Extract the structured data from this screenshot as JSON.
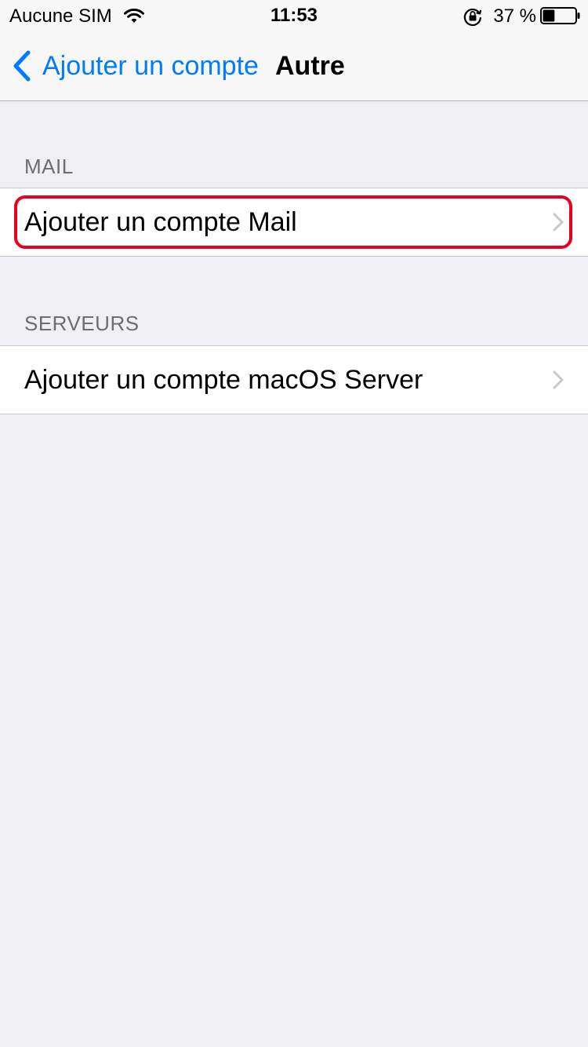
{
  "status_bar": {
    "carrier": "Aucune SIM",
    "time": "11:53",
    "battery": "37 %",
    "battery_level": 0.37,
    "icons": [
      "wifi-icon",
      "lock-rotation-icon",
      "battery-icon"
    ]
  },
  "nav": {
    "back_label": "Ajouter un compte",
    "title": "Autre",
    "back_icon": "chevron-left-icon"
  },
  "sections": [
    {
      "header": "MAIL",
      "items": [
        {
          "label": "Ajouter un compte Mail",
          "icon": "chevron-right-icon",
          "highlighted": true
        }
      ]
    },
    {
      "header": "SERVEURS",
      "items": [
        {
          "label": "Ajouter un compte macOS Server",
          "icon": "chevron-right-icon",
          "highlighted": false
        }
      ]
    }
  ],
  "colors": {
    "accent": "#007aff",
    "background": "#efeff4",
    "highlight": "#e8001c",
    "section_header": "#6d6d72",
    "chevron": "#c7c7cc"
  }
}
